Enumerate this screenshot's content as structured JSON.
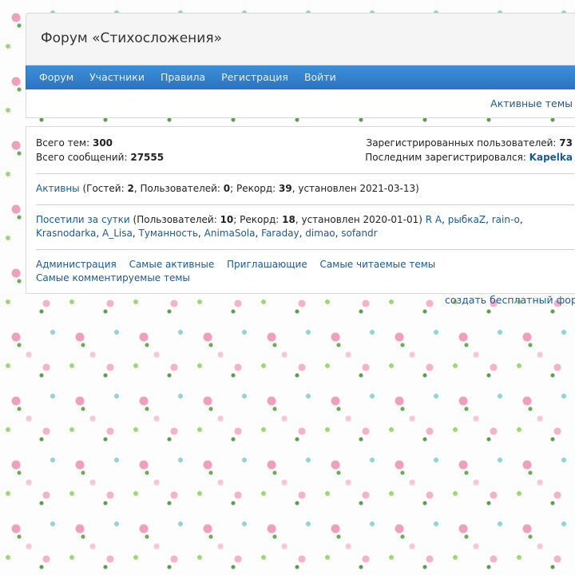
{
  "header": {
    "title": "Форум «Стихосложения»"
  },
  "nav": {
    "items": [
      {
        "label": "Форум"
      },
      {
        "label": "Участники"
      },
      {
        "label": "Правила"
      },
      {
        "label": "Регистрация"
      },
      {
        "label": "Войти"
      }
    ]
  },
  "subbar": {
    "active_topics": "Активные темы"
  },
  "stats": {
    "topics_label": "Всего тем:",
    "topics_value": "300",
    "posts_label": "Всего сообщений:",
    "posts_value": "27555",
    "registered_label": "Зарегистрированных пользователей:",
    "registered_value": "73",
    "last_registered_label": "Последним зарегистрировался:",
    "last_registered_value": "Kapelka"
  },
  "online": {
    "link": "Активны",
    "t1": "(Гостей:",
    "guests": "2",
    "t2": ", Пользователей:",
    "users": "0",
    "t3": "; Рекорд:",
    "record": "39",
    "t4": ", установлен 2021-03-13)"
  },
  "daily": {
    "link": "Посетили за сутки",
    "t1": "(Пользователей:",
    "users": "10",
    "t2": "; Рекорд:",
    "record": "18",
    "t3": ", установлен 2020-01-01)",
    "visitors": [
      "R A",
      "рыбкаZ",
      "rain-o",
      "Krasnodarka",
      "A_Lisa",
      "Туманность",
      "AnimaSola",
      "Faraday",
      "dimao",
      "sofandr"
    ]
  },
  "links": {
    "items": [
      {
        "label": "Администрация"
      },
      {
        "label": "Самые активные"
      },
      {
        "label": "Приглашающие"
      },
      {
        "label": "Самые читаемые темы"
      },
      {
        "label": "Самые комментируемые темы"
      }
    ]
  },
  "footer": {
    "create_forum": "создать бесплатный форум"
  }
}
